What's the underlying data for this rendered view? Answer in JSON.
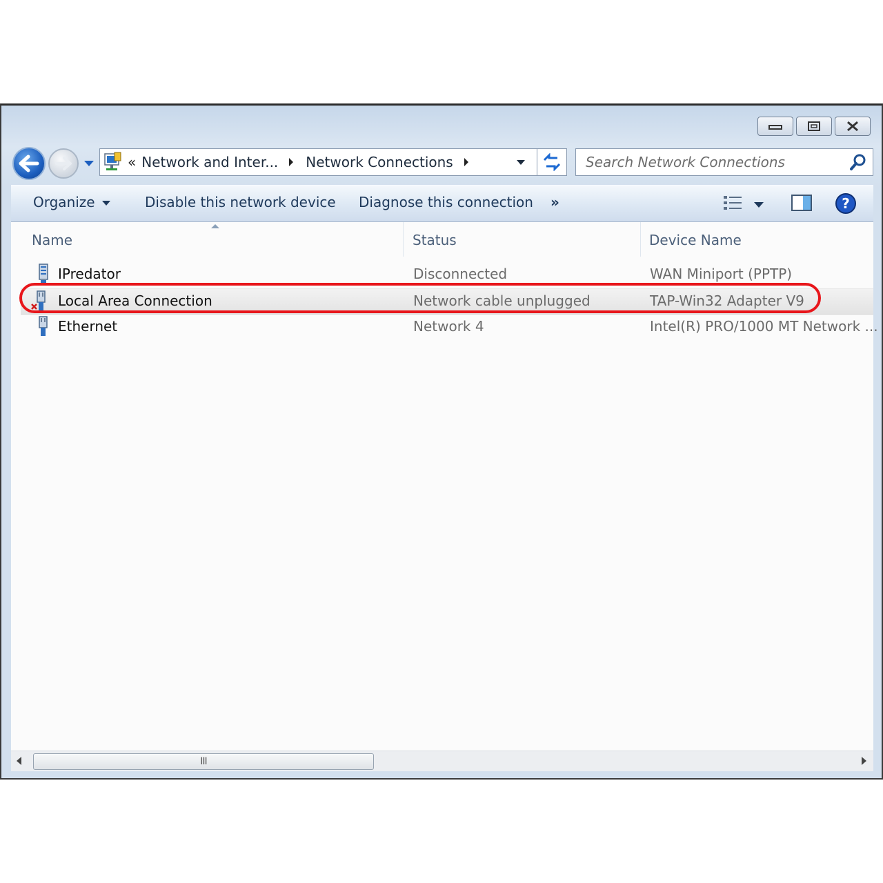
{
  "window": {
    "caption": {
      "minimize_icon": "minimize-icon",
      "maximize_icon": "maximize-icon",
      "close_icon": "close-icon"
    }
  },
  "nav": {
    "breadcrumb_overflow": "«",
    "breadcrumb": [
      "Network and Inter...",
      "Network Connections"
    ],
    "search_placeholder": "Search Network Connections"
  },
  "toolbar": {
    "organize": "Organize",
    "disable": "Disable this network device",
    "diagnose": "Diagnose this connection",
    "more": "»"
  },
  "columns": {
    "name": "Name",
    "status": "Status",
    "device": "Device Name"
  },
  "rows": [
    {
      "name": "IPredator",
      "status": "Disconnected",
      "device": "WAN Miniport (PPTP)",
      "icon": "vpn-connection-icon"
    },
    {
      "name": "Local Area Connection",
      "status": "Network cable unplugged",
      "device": "TAP-Win32 Adapter V9",
      "icon": "unplugged-network-icon"
    },
    {
      "name": "Ethernet",
      "status": "Network 4",
      "device": "Intel(R) PRO/1000 MT Network ...",
      "icon": "network-adapter-icon"
    }
  ],
  "colors": {
    "highlight": "#e8161b",
    "toolbar_text": "#1e395b"
  },
  "scrollbar": {
    "grip": "III"
  }
}
